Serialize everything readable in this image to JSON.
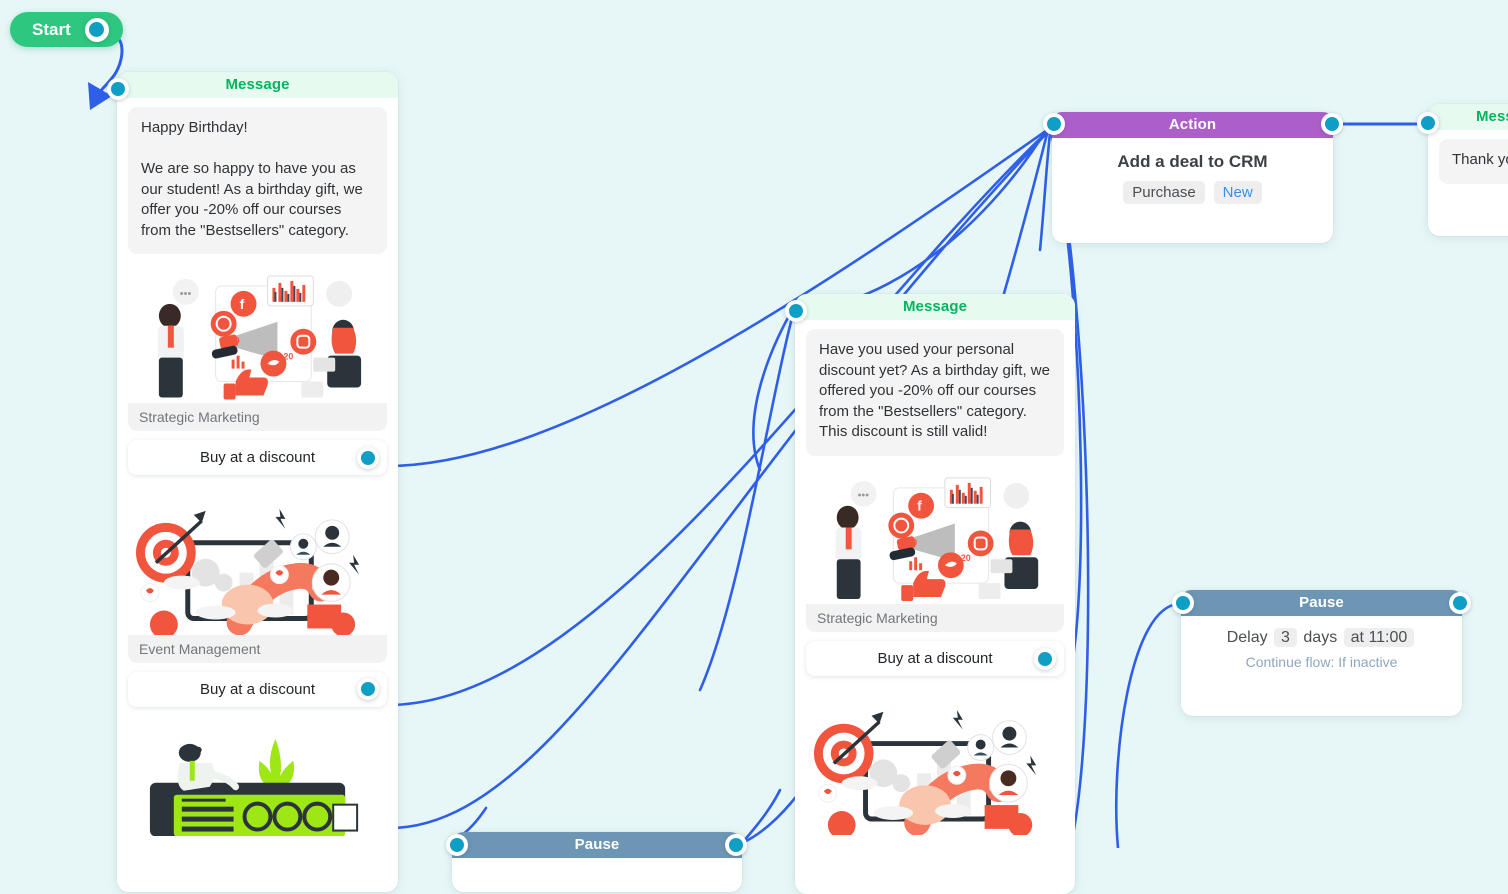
{
  "canvas": {
    "background_color": "#e7f7f7",
    "edge_color": "#2f5fe8",
    "port_color": "#109fc4"
  },
  "start": {
    "label": "Start",
    "color": "#2ec77f",
    "port_icon": "circle-port-icon"
  },
  "nodes": [
    {
      "id": "message-1",
      "type": "message",
      "header": "Message",
      "header_color": "#e6faf0",
      "header_text_color": "#07b45e",
      "bubble_text": "Happy Birthday!\n\nWe are so happy to have you as our student! As a birthday gift, we offer you -20% off our courses from the \"Bestsellers\" category.",
      "cards": [
        {
          "caption": "Strategic Marketing",
          "illustration": "social-media-marketing-illustration",
          "button": "Buy at a discount"
        },
        {
          "caption": "Event Management",
          "illustration": "magnet-audience-illustration",
          "button": "Buy at a discount"
        },
        {
          "caption": "",
          "illustration": "green-console-operator-illustration",
          "button": ""
        }
      ]
    },
    {
      "id": "message-2",
      "type": "message",
      "header": "Message",
      "header_color": "#e6faf0",
      "header_text_color": "#07b45e",
      "bubble_text": "Have you used your personal discount yet? As a birthday gift, we offered you -20% off our courses from the \"Bestsellers\" category. This discount is still valid!",
      "cards": [
        {
          "caption": "Strategic Marketing",
          "illustration": "social-media-marketing-illustration",
          "button": "Buy at a discount"
        },
        {
          "caption": "",
          "illustration": "magnet-audience-illustration",
          "button": ""
        }
      ]
    },
    {
      "id": "message-3",
      "type": "message",
      "header": "Message",
      "header_color": "#e6faf0",
      "header_text_color": "#07b45e",
      "bubble_text": "Thank yo"
    },
    {
      "id": "action-1",
      "type": "action",
      "header": "Action",
      "header_color": "#ac5fc8",
      "title": "Add a deal to CRM",
      "chips": [
        {
          "label": "Purchase",
          "style": "default"
        },
        {
          "label": "New",
          "style": "blue"
        }
      ]
    },
    {
      "id": "pause-1",
      "type": "pause",
      "header": "Pause",
      "header_color": "#6d96b4",
      "delay_label": "Delay",
      "delay_value": "3",
      "delay_unit": "days",
      "time_label": "at 11:00",
      "continue_label": "Continue flow: If inactive"
    },
    {
      "id": "pause-2",
      "type": "pause",
      "header": "Pause",
      "header_color": "#6d96b4"
    }
  ]
}
